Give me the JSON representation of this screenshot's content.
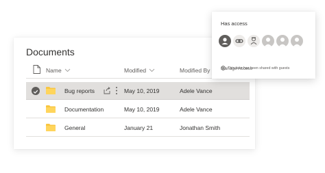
{
  "documents": {
    "title": "Documents",
    "columns": {
      "name": "Name",
      "modified": "Modified",
      "modified_by": "Modified By"
    },
    "rows": [
      {
        "name": "Bug reports",
        "modified": "May 10, 2019",
        "modified_by": "Adele Vance",
        "selected": true
      },
      {
        "name": "Documentation",
        "modified": "May 10, 2019",
        "modified_by": "Adele Vance",
        "selected": false
      },
      {
        "name": "General",
        "modified": "January 21",
        "modified_by": "Jonathan Smith",
        "selected": false
      }
    ]
  },
  "access_popup": {
    "title": "Has access",
    "avatars": [
      "person-avatar-icon",
      "link-icon",
      "guest-avatar-icon",
      "person-placeholder-icon",
      "person-placeholder-icon",
      "person-placeholder-icon"
    ],
    "note": "This item has been shared with guests",
    "manage_link": "Manage Access"
  },
  "colors": {
    "folder": "#f8c642",
    "selected_row": "#e1dfdd",
    "text": "#323130",
    "muted": "#605e5c"
  }
}
